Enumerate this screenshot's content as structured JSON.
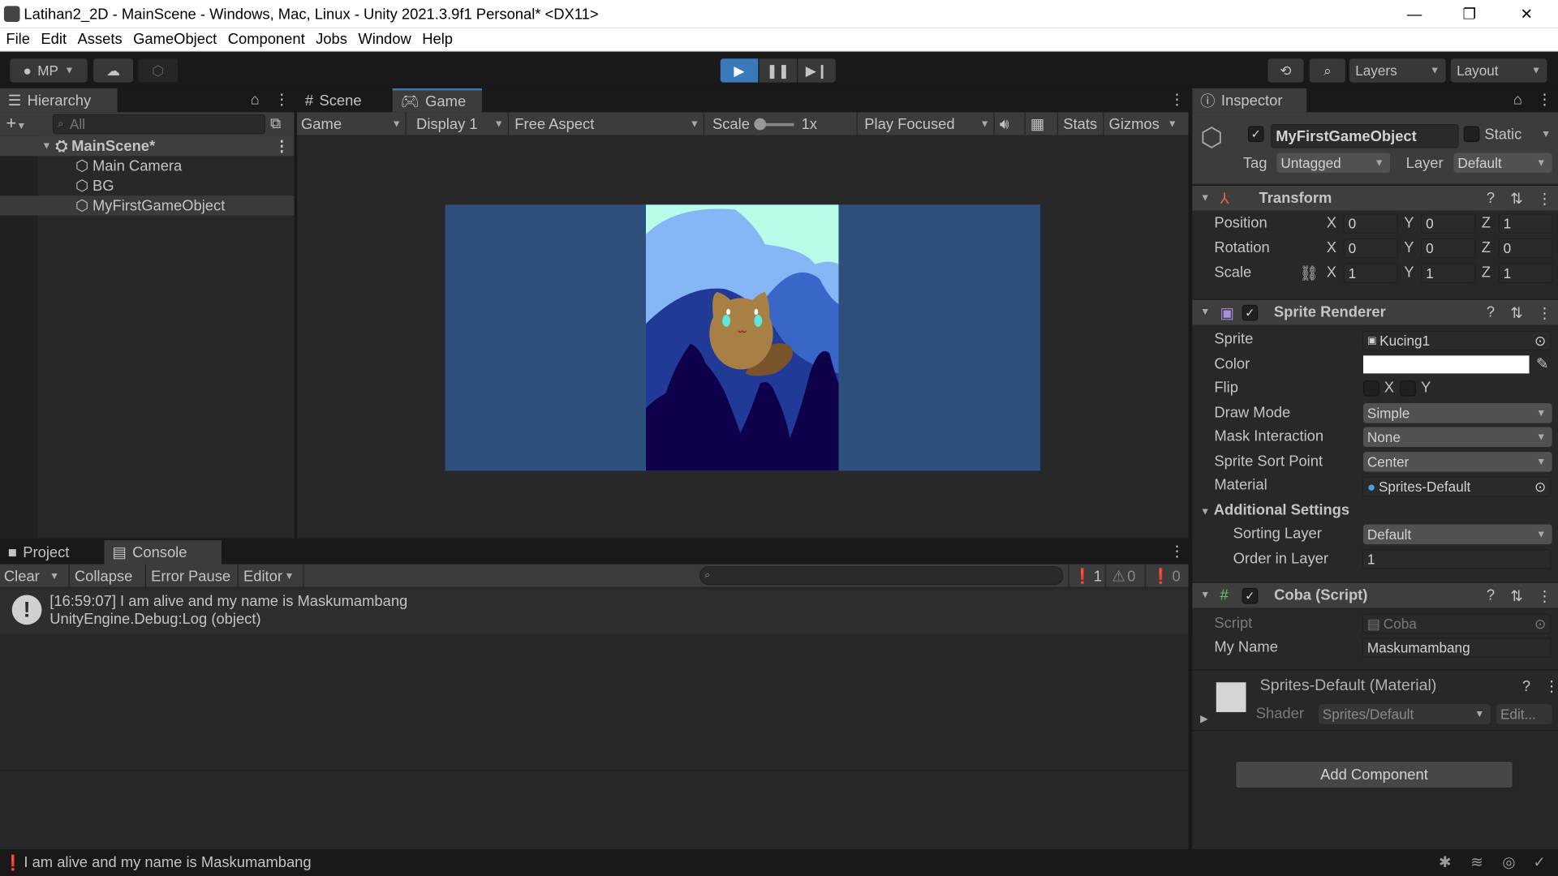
{
  "window": {
    "title": "Latihan2_2D - MainScene - Windows, Mac, Linux - Unity 2021.3.9f1 Personal* <DX11>",
    "minimize": "—",
    "maximize": "❐",
    "close": "✕"
  },
  "menu": [
    "File",
    "Edit",
    "Assets",
    "GameObject",
    "Component",
    "Jobs",
    "Window",
    "Help"
  ],
  "toolbar": {
    "account": "MP",
    "layers": "Layers",
    "layout": "Layout"
  },
  "hierarchy": {
    "tab": "Hierarchy",
    "search_placeholder": "All",
    "scene": "MainScene*",
    "items": [
      "Main Camera",
      "BG",
      "MyFirstGameObject"
    ]
  },
  "game": {
    "tabs": [
      "Scene",
      "Game"
    ],
    "mode": "Game",
    "display": "Display 1",
    "aspect": "Free Aspect",
    "scale_label": "Scale",
    "scale_value": "1x",
    "play_mode": "Play Focused",
    "stats": "Stats",
    "gizmos": "Gizmos",
    "bg_color": "#2e4f7b"
  },
  "inspector": {
    "tab": "Inspector",
    "object_name": "MyFirstGameObject",
    "static": "Static",
    "tag_label": "Tag",
    "tag": "Untagged",
    "layer_label": "Layer",
    "layer": "Default",
    "transform": {
      "title": "Transform",
      "rows": [
        {
          "label": "Position",
          "x": "0",
          "y": "0",
          "z": "1"
        },
        {
          "label": "Rotation",
          "x": "0",
          "y": "0",
          "z": "0"
        },
        {
          "label": "Scale",
          "x": "1",
          "y": "1",
          "z": "1"
        }
      ]
    },
    "sprite_renderer": {
      "title": "Sprite Renderer",
      "sprite_label": "Sprite",
      "sprite": "Kucing1",
      "color_label": "Color",
      "color": "#ffffff",
      "flip_label": "Flip",
      "flip_x": "X",
      "flip_y": "Y",
      "draw_mode_label": "Draw Mode",
      "draw_mode": "Simple",
      "mask_label": "Mask Interaction",
      "mask": "None",
      "sort_point_label": "Sprite Sort Point",
      "sort_point": "Center",
      "material_label": "Material",
      "material": "Sprites-Default",
      "additional": "Additional Settings",
      "sorting_layer_label": "Sorting Layer",
      "sorting_layer": "Default",
      "order_label": "Order in Layer",
      "order": "1"
    },
    "script": {
      "title": "Coba (Script)",
      "script_label": "Script",
      "script": "Coba",
      "name_label": "My Name",
      "name": "Maskumambang"
    },
    "material": {
      "title": "Sprites-Default (Material)",
      "shader_label": "Shader",
      "shader": "Sprites/Default",
      "edit": "Edit..."
    },
    "add_component": "Add Component"
  },
  "console": {
    "tabs": [
      "Project",
      "Console"
    ],
    "clear": "Clear",
    "collapse": "Collapse",
    "error_pause": "Error Pause",
    "editor": "Editor",
    "counts": {
      "log": "1",
      "warn": "0",
      "error": "0"
    },
    "entries": [
      {
        "line1": "[16:59:07] I am alive and my name is Maskumambang",
        "line2": "UnityEngine.Debug:Log (object)"
      }
    ]
  },
  "status": {
    "message": "I am alive and my name is Maskumambang"
  }
}
